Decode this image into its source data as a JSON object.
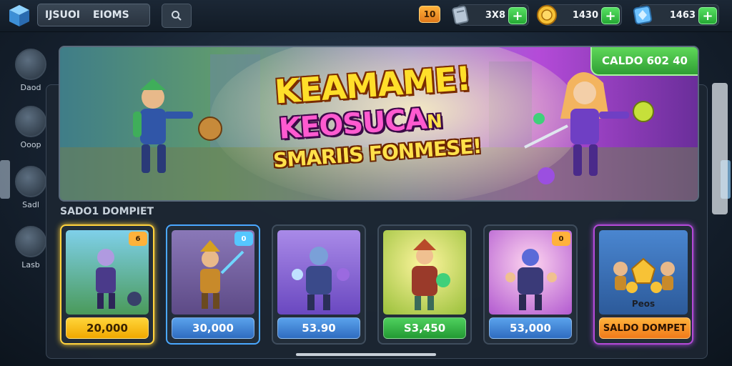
{
  "topbar": {
    "name_parts": [
      "IJSUOI",
      "EIOMS"
    ],
    "level": "10",
    "currencies": [
      {
        "icon": "card-icon",
        "value": "3X8",
        "color": "#b7c6d6"
      },
      {
        "icon": "coin-icon",
        "value": "1430",
        "color": "#f7c236"
      },
      {
        "icon": "gem-icon",
        "value": "1463",
        "color": "#6ec2ff"
      }
    ]
  },
  "sidebar": {
    "items": [
      {
        "label": "Daod",
        "icon": "hero-icon"
      },
      {
        "label": "Ooop",
        "icon": "cat-icon"
      },
      {
        "label": "Sadl",
        "icon": "warrior-icon"
      },
      {
        "label": "Lasb",
        "icon": "chest-icon"
      }
    ]
  },
  "banner": {
    "badge": "CALDO 602 40",
    "line1": "KEAMAME!",
    "line2": "KEOSUCA",
    "line2_suffix": "N",
    "line3": "SMARIIS FONMESE!"
  },
  "section_label": "SADO1 DOMPIET",
  "cards": [
    {
      "name": "card-1",
      "price": "20,000",
      "price_color": "#f5b300",
      "tag": "6",
      "tag_color": "#ffb23b",
      "bg": "#4aa3c8",
      "border": "#ffd23d"
    },
    {
      "name": "card-2",
      "price": "30,000",
      "price_color": "#3f86d8",
      "tag": "0",
      "tag_color": "#55c7ff",
      "bg": "#7a66a8",
      "border": "#4aa8ff"
    },
    {
      "name": "card-3",
      "price": "53.90",
      "price_color": "#3f86d8",
      "tag": "",
      "tag_color": "",
      "bg": "#8b6ad6",
      "border": "#3f4d5d"
    },
    {
      "name": "card-4",
      "price": "S3,450",
      "price_color": "#3bb54a",
      "tag": "",
      "tag_color": "",
      "bg": "#d9d448",
      "border": "#3f4d5d"
    },
    {
      "name": "card-5",
      "price": "53,000",
      "price_color": "#3f86d8",
      "tag": "0",
      "tag_color": "#ffb23b",
      "bg": "#c57ad8",
      "border": "#3f4d5d"
    },
    {
      "name": "card-6",
      "price": "SALDO DOMPET",
      "price_color": "#ff9a1a",
      "tag": "",
      "tag_color": "",
      "bg": "#3b6fb8",
      "border": "#b44ad8",
      "art_label": "Peos"
    }
  ]
}
